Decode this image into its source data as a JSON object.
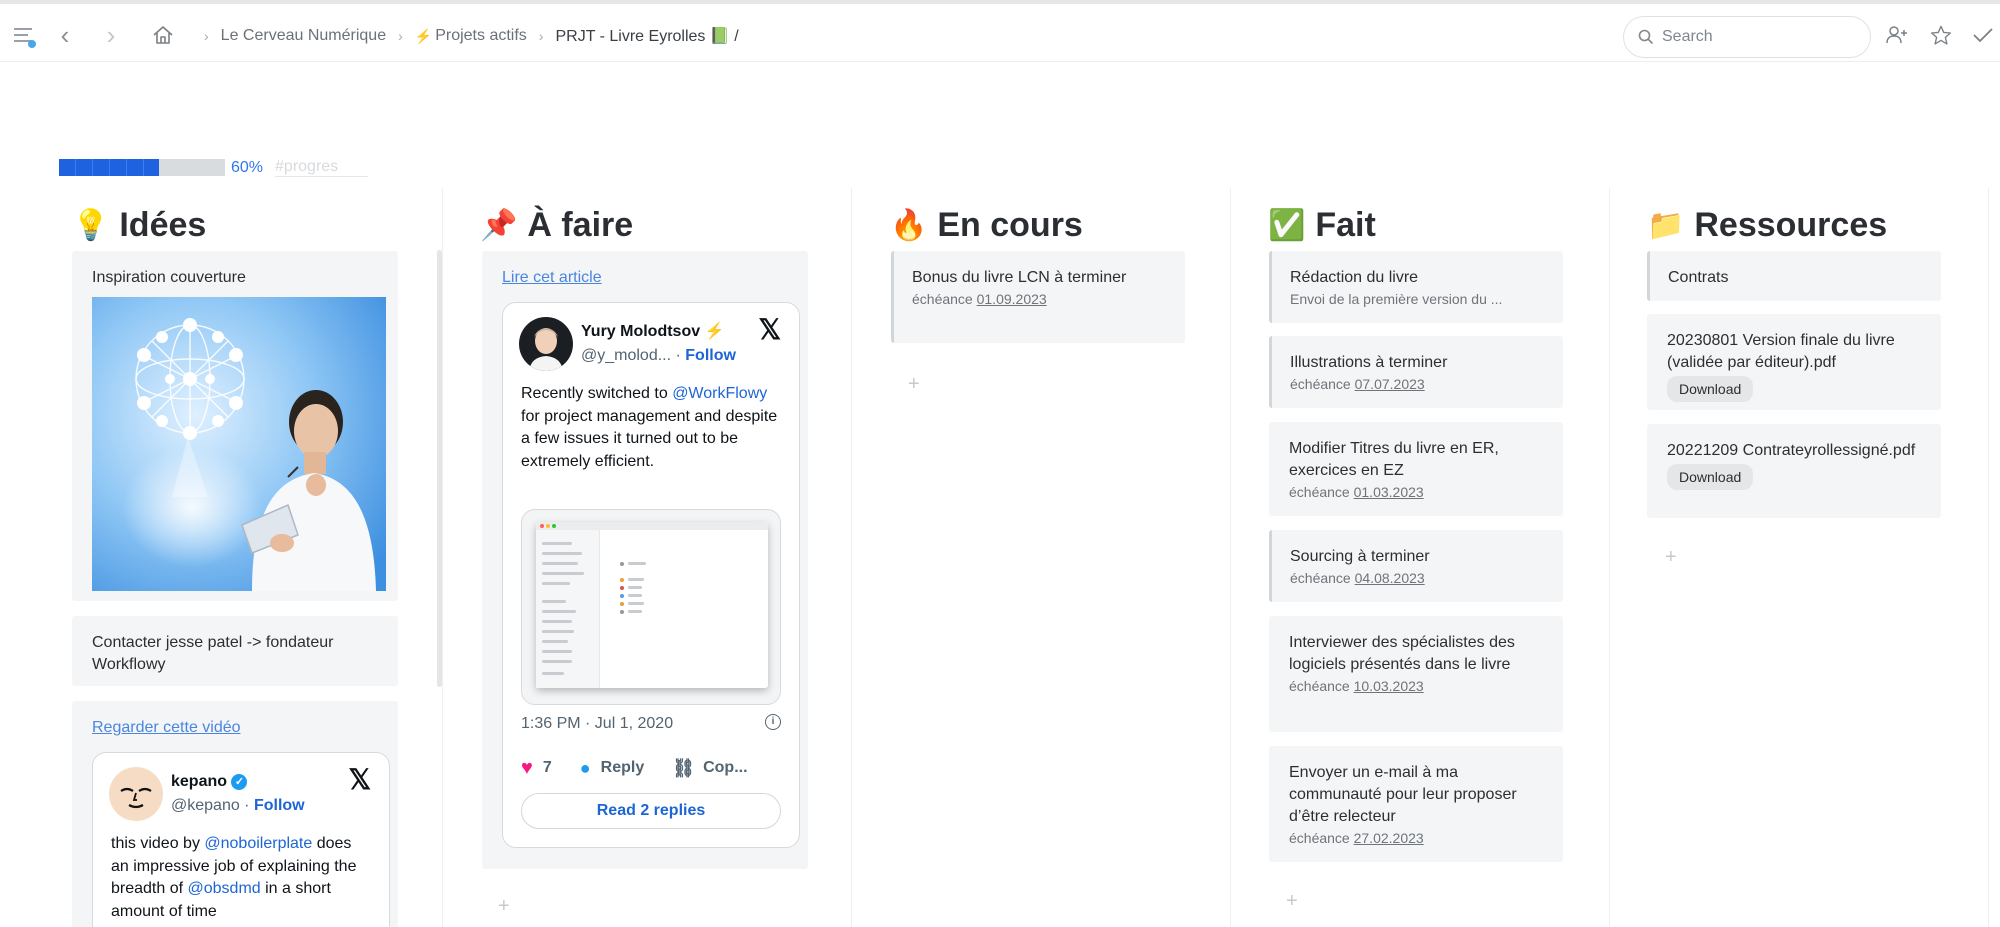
{
  "topbar": {
    "breadcrumbs": [
      "Le Cerveau Numérique",
      "Projets actifs",
      "PRJT - Livre Eyrolles 📗 /"
    ],
    "search_placeholder": "Search"
  },
  "progress": {
    "value": 0.6,
    "label": "60%",
    "tag": "#progres"
  },
  "columns": {
    "idees": {
      "emoji": "💡",
      "title": "Idées",
      "cards": {
        "c1": {
          "title": "Inspiration couverture"
        },
        "c2": {
          "title": "Contacter jesse patel -> fondateur Workflowy"
        },
        "c3": {
          "link": "Regarder cette vidéo"
        }
      },
      "tweet": {
        "name": "kepano",
        "handle": "@kepano",
        "follow": "Follow",
        "text_1": "this video by ",
        "mention_1": "@noboilerplate",
        "text_2": " does an impressive job of explaining the breadth of ",
        "mention_2": "@obsdmd",
        "text_3": " in a short amount of time"
      }
    },
    "afaire": {
      "emoji": "📌",
      "title": "À faire",
      "link": "Lire cet article",
      "tweet": {
        "name": "Yury Molodtsov",
        "badge": "⚡",
        "handle": "@y_molod...",
        "follow": "Follow",
        "text_1": "Recently switched to ",
        "mention": "@WorkFlowy",
        "text_2": " for project management and despite a few issues it turned out to be extremely efficient.",
        "time": "1:36 PM · Jul 1, 2020",
        "likes": "7",
        "reply": "Reply",
        "copy": "Cop...",
        "read_replies": "Read 2 replies"
      }
    },
    "encours": {
      "emoji": "🔥",
      "title": "En cours",
      "cards": {
        "c1": {
          "title": "Bonus du livre LCN à terminer",
          "due_label": "échéance",
          "due": "01.09.2023"
        }
      }
    },
    "fait": {
      "emoji": "✅",
      "title": "Fait",
      "cards": {
        "c1": {
          "title": "Rédaction du livre",
          "note": "Envoi de la première version du ..."
        },
        "c2": {
          "title": "Illustrations à terminer",
          "due_label": "échéance",
          "due": "07.07.2023"
        },
        "c3": {
          "title": "Modifier Titres du livre en ER, exercices en EZ",
          "due_label": "échéance",
          "due": "01.03.2023"
        },
        "c4": {
          "title": "Sourcing à terminer",
          "due_label": "échéance",
          "due": "04.08.2023"
        },
        "c5": {
          "title": "Interviewer des spécialistes des logiciels présentés dans le livre",
          "due_label": "échéance",
          "due": "10.03.2023"
        },
        "c6": {
          "title": "Envoyer un e-mail à ma communauté pour leur proposer d’être relecteur",
          "due_label": "échéance",
          "due": "27.02.2023"
        }
      }
    },
    "ressources": {
      "emoji": "📁",
      "title": "Ressources",
      "cards": {
        "c1": {
          "title": "Contrats"
        },
        "c2": {
          "title": "20230801 Version finale du livre (validée par éditeur).pdf",
          "button": "Download"
        },
        "c3": {
          "title": "20221209 Contrateyrollessigné.pdf",
          "button": "Download"
        }
      }
    }
  },
  "add_symbol": "+",
  "colors": {
    "accent_blue": "#1f62e0",
    "link": "#4a86e0",
    "card_bg": "#f4f5f6",
    "twitter_blue": "#1d65d6"
  }
}
